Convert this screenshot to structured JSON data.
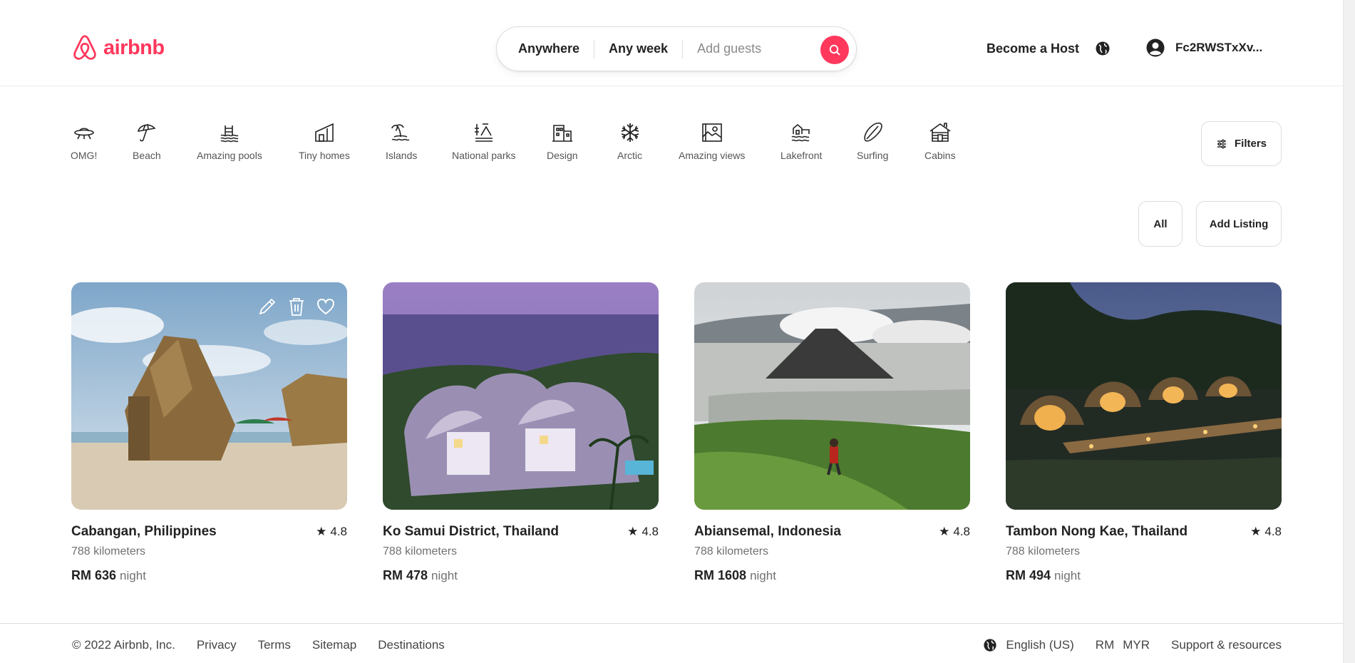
{
  "brand": {
    "name": "airbnb",
    "color": "#ff385c"
  },
  "search": {
    "location": "Anywhere",
    "date": "Any week",
    "guests_placeholder": "Add guests"
  },
  "header": {
    "become_host": "Become a Host",
    "user_name": "Fc2RWSTxXv..."
  },
  "categories": [
    {
      "label": "OMG!",
      "icon": "ufo-icon"
    },
    {
      "label": "Beach",
      "icon": "umbrella-icon"
    },
    {
      "label": "Amazing pools",
      "icon": "pool-icon"
    },
    {
      "label": "Tiny homes",
      "icon": "tiny-home-icon"
    },
    {
      "label": "Islands",
      "icon": "island-icon"
    },
    {
      "label": "National parks",
      "icon": "national-park-icon"
    },
    {
      "label": "Design",
      "icon": "design-building-icon"
    },
    {
      "label": "Arctic",
      "icon": "snowflake-icon"
    },
    {
      "label": "Amazing views",
      "icon": "view-icon"
    },
    {
      "label": "Lakefront",
      "icon": "lakefront-icon"
    },
    {
      "label": "Surfing",
      "icon": "surfboard-icon"
    },
    {
      "label": "Cabins",
      "icon": "cabin-icon"
    }
  ],
  "filters_label": "Filters",
  "actions": {
    "all": "All",
    "add_listing": "Add Listing"
  },
  "listings": [
    {
      "title": "Cabangan, Philippines",
      "rating": "4.8",
      "distance": "788 kilometers",
      "price": "RM 636",
      "unit": "night",
      "scene": "beach-huts"
    },
    {
      "title": "Ko Samui District, Thailand",
      "rating": "4.8",
      "distance": "788 kilometers",
      "price": "RM 478",
      "unit": "night",
      "scene": "dome-villas"
    },
    {
      "title": "Abiansemal, Indonesia",
      "rating": "4.8",
      "distance": "788 kilometers",
      "price": "RM 1608",
      "unit": "night",
      "scene": "volcano"
    },
    {
      "title": "Tambon Nong Kae, Thailand",
      "rating": "4.8",
      "distance": "788 kilometers",
      "price": "RM 494",
      "unit": "night",
      "scene": "pod-villas-night"
    }
  ],
  "footer": {
    "copyright": "© 2022 Airbnb, Inc.",
    "links": [
      "Privacy",
      "Terms",
      "Sitemap",
      "Destinations"
    ],
    "language": "English (US)",
    "currency_symbol": "RM",
    "currency_code": "MYR",
    "support": "Support & resources"
  }
}
